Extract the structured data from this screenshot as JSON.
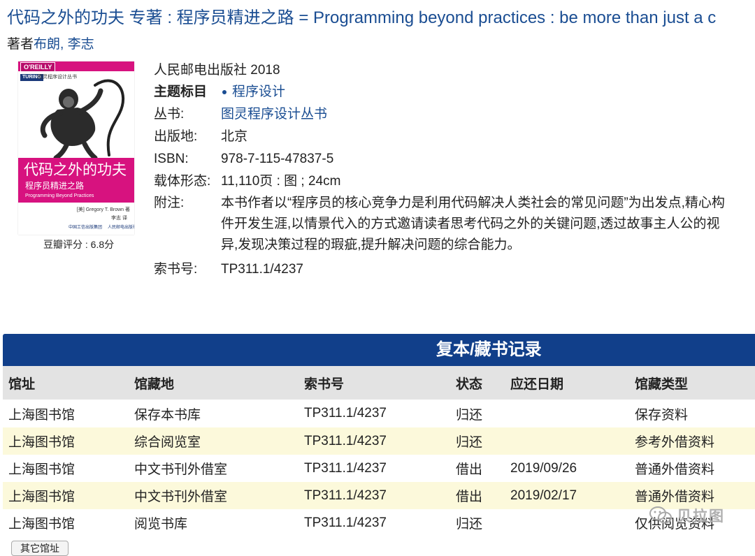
{
  "record": {
    "title": "代码之外的功夫 专著 : 程序员精进之路 = Programming beyond practices : be more than just a c",
    "authors_label": "著者",
    "authors": "布朗, 李志",
    "publisher_line": "人民邮电出版社 2018",
    "subject_label": "主题标目",
    "subject": "程序设计",
    "series_label": "丛书:",
    "series": "图灵程序设计丛书",
    "place_label": "出版地:",
    "place": "北京",
    "isbn_label": "ISBN:",
    "isbn": "978-7-115-47837-5",
    "format_label": "载体形态:",
    "format": "11,110页 : 图 ; 24cm",
    "note_label": "附注:",
    "note_lines": [
      "本书作者以“程序员的核心竞争力是利用代码解决人类社会的常见问题”为出发点,精心构",
      "件开发生涯,以情景代入的方式邀请读者思考代码之外的关键问题,透过故事主人公的视",
      "异,发现决策过程的瑕疵,提升解决问题的综合能力。"
    ],
    "callno_label": "索书号:",
    "callno": "TP311.1/4237"
  },
  "cover": {
    "brand": "O'REILLY",
    "turing": "TURING",
    "series_mini": "图灵程序设计丛书",
    "cn_title": "代码之外的功夫",
    "cn_subtitle": "程序员精进之路",
    "en_title": "Programming Beyond Practices",
    "author_mini": "[美] Gregory T. Brown 著",
    "translator_mini": "李志 译",
    "publisher_mini": "中国工信出版集团",
    "publisher_mini2": "人民邮电出版社",
    "accent": "#d7127f"
  },
  "rating": "豆瓣评分 : 6.8分",
  "holdings": {
    "title": "复本/藏书记录",
    "columns": [
      "馆址",
      "馆藏地",
      "索书号",
      "状态",
      "应还日期",
      "馆藏类型"
    ],
    "rows": [
      [
        "上海图书馆",
        "保存本书库",
        "TP311.1/4237",
        "归还",
        "",
        "保存资料"
      ],
      [
        "上海图书馆",
        "综合阅览室",
        "TP311.1/4237",
        "归还",
        "",
        "参考外借资料"
      ],
      [
        "上海图书馆",
        "中文书刊外借室",
        "TP311.1/4237",
        "借出",
        "2019/09/26",
        "普通外借资料"
      ],
      [
        "上海图书馆",
        "中文书刊外借室",
        "TP311.1/4237",
        "借出",
        "2019/02/17",
        "普通外借资料"
      ],
      [
        "上海图书馆",
        "阅览书库",
        "TP311.1/4237",
        "归还",
        "",
        "仅供阅览资料"
      ]
    ],
    "header_color": "#113f8a",
    "stripe_color": "#fcf9db"
  },
  "more_button": "其它馆址",
  "watermark": "贝拉图"
}
